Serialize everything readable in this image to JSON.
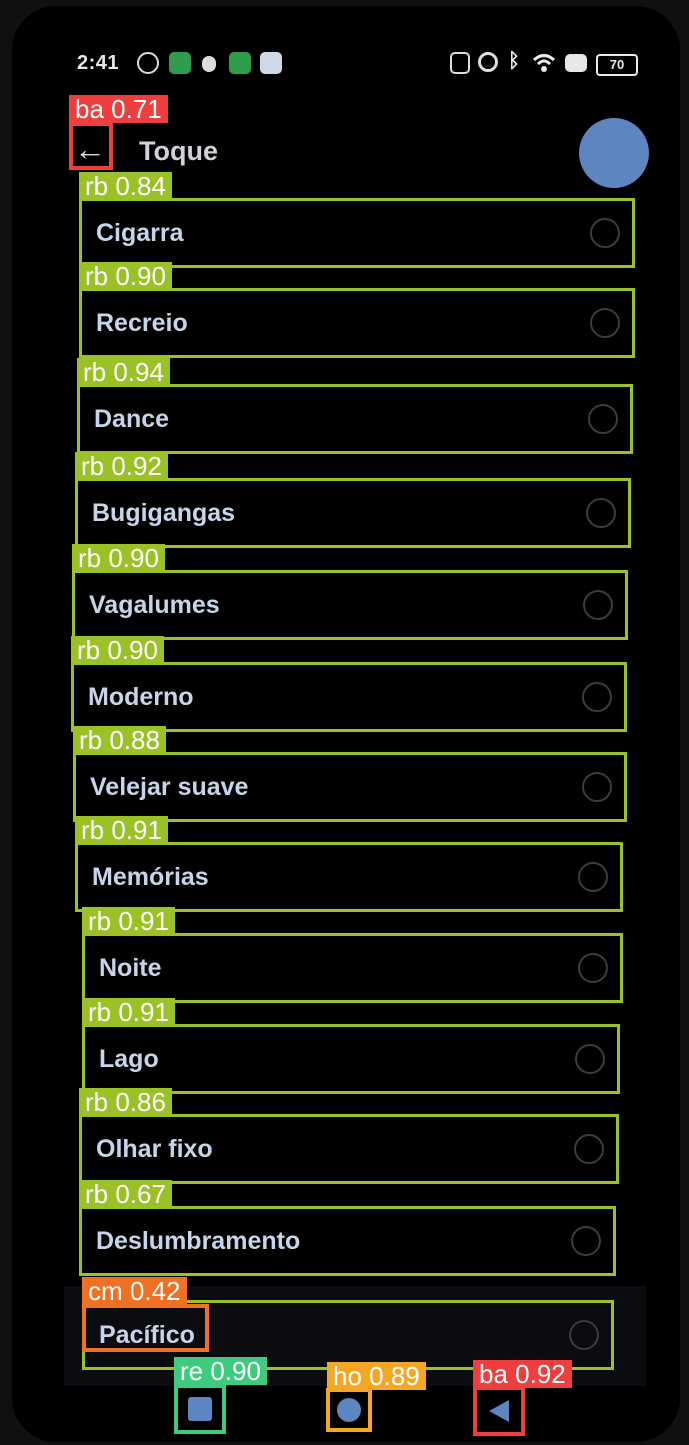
{
  "status_bar": {
    "time": "2:41",
    "battery": "70",
    "icons": [
      "settings-icon",
      "calendar-icon",
      "bug-icon",
      "green-app-icon",
      "white-app-icon",
      "nfc-icon",
      "alarm-icon",
      "bluetooth-icon",
      "wifi-icon",
      "sim-icon"
    ]
  },
  "app_bar": {
    "back_icon": "←",
    "title": "Toque"
  },
  "ringtones": [
    {
      "label": "Cigarra",
      "detection": "rb 0.84"
    },
    {
      "label": "Recreio",
      "detection": "rb 0.90"
    },
    {
      "label": "Dance",
      "detection": "rb 0.94"
    },
    {
      "label": "Bugigangas",
      "detection": "rb 0.92"
    },
    {
      "label": "Vagalumes",
      "detection": "rb 0.90"
    },
    {
      "label": "Moderno",
      "detection": "rb 0.90"
    },
    {
      "label": "Velejar suave",
      "detection": "rb 0.88"
    },
    {
      "label": "Memórias",
      "detection": "rb 0.91"
    },
    {
      "label": "Noite",
      "detection": "rb 0.91"
    },
    {
      "label": "Lago",
      "detection": "rb 0.91"
    },
    {
      "label": "Olhar fixo",
      "detection": "rb 0.86"
    },
    {
      "label": "Deslumbramento",
      "detection": "rb 0.67"
    },
    {
      "label": "Pacífico",
      "detection": "cm 0.42"
    }
  ],
  "detections": {
    "back": "ba 0.71",
    "recents": "re 0.90",
    "home": "ho 0.89",
    "nav_back": "ba 0.92"
  },
  "colors": {
    "radio_box": "#9ac126",
    "back_box": "#ef3e3e",
    "checkbox_box": "#f07024",
    "recents_box": "#3ecb7d",
    "home_box": "#f4a624",
    "fab": "#5d86c0"
  }
}
